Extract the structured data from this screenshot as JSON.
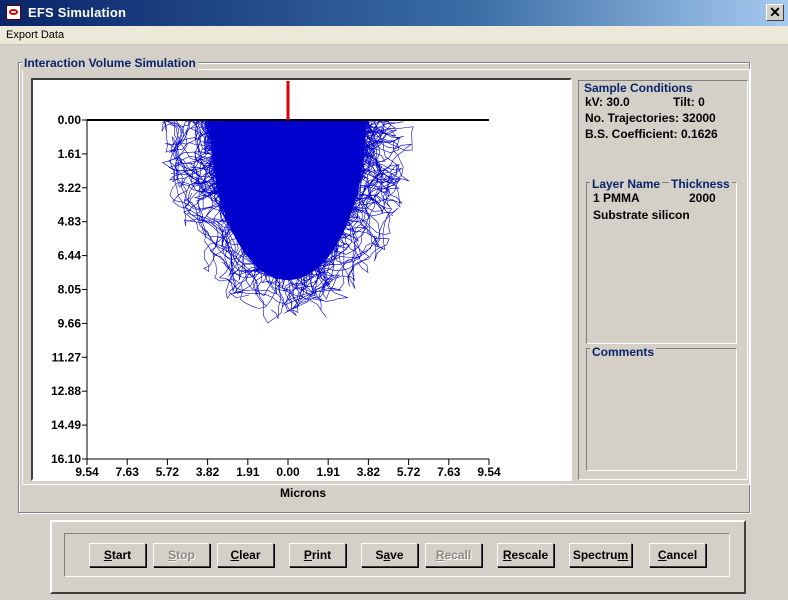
{
  "window": {
    "title": "EFS Simulation",
    "close_glyph": "✕",
    "icon": "app-icon"
  },
  "menu": {
    "items": [
      "Export Data"
    ]
  },
  "simulation": {
    "group_title": "Interaction Volume Simulation",
    "x_axis_title": "Microns"
  },
  "chart_data": {
    "type": "scatter",
    "title": "Interaction Volume Simulation",
    "xlabel": "Microns",
    "ylabel": "",
    "x_ticks": [
      "9.54",
      "7.63",
      "5.72",
      "3.82",
      "1.91",
      "0.00",
      "1.91",
      "3.82",
      "5.72",
      "7.63",
      "9.54"
    ],
    "y_ticks": [
      "0.00",
      "1.61",
      "3.22",
      "4.83",
      "6.44",
      "8.05",
      "9.66",
      "11.27",
      "12.88",
      "14.49",
      "16.10"
    ],
    "xlim": [
      -9.54,
      9.54
    ],
    "ylim": [
      0,
      16.1
    ],
    "grid": false,
    "trajectory_color": "#0000cc",
    "beam_color": "#dd0000",
    "cloud_extent": {
      "half_width": 6.0,
      "max_depth": 9.9,
      "dense_half_width": 3.7,
      "dense_depth": 7.6
    }
  },
  "sample_conditions": {
    "title": "Sample Conditions",
    "kv": "kV: 30.0",
    "tilt": "Tilt:  0",
    "trajectories": "No. Trajectories: 32000",
    "bs_coefficient": "B.S. Coefficient: 0.1626"
  },
  "layers": {
    "title_name": "Layer Name",
    "title_thickness": "Thickness",
    "row1_name": "1  PMMA",
    "row1_thickness": "2000",
    "substrate": "Substrate  silicon"
  },
  "comments": {
    "title": "Comments"
  },
  "buttons": [
    {
      "pre": "",
      "key": "S",
      "post": "tart",
      "enabled": true
    },
    {
      "pre": "",
      "key": "S",
      "post": "top",
      "enabled": false
    },
    {
      "pre": "",
      "key": "C",
      "post": "lear",
      "enabled": true
    },
    {
      "pre": "",
      "key": "P",
      "post": "rint",
      "enabled": true
    },
    {
      "pre": "S",
      "key": "a",
      "post": "ve",
      "enabled": true
    },
    {
      "pre": "",
      "key": "R",
      "post": "ecall",
      "enabled": false
    },
    {
      "pre": "",
      "key": "R",
      "post": "escale",
      "enabled": true
    },
    {
      "pre": "Spectru",
      "key": "m",
      "post": "",
      "enabled": true
    },
    {
      "pre": "",
      "key": "C",
      "post": "ancel",
      "enabled": true
    }
  ]
}
